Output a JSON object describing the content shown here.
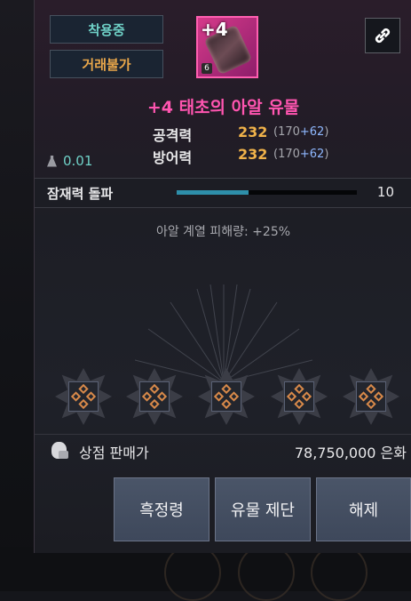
{
  "header": {
    "badge_wearing": "착용중",
    "badge_untradable": "거래불가",
    "item_level": "+4",
    "lock_number": "6",
    "link_icon": "link-icon"
  },
  "item": {
    "name": "+4 태초의 아알 유물",
    "name_color": "#ff55b0"
  },
  "stats": [
    {
      "label": "공격력",
      "value": "232",
      "base": "(170",
      "bonus": "+62",
      "close": ")"
    },
    {
      "label": "방어력",
      "value": "232",
      "base": "(170",
      "bonus": "+62",
      "close": ")"
    }
  ],
  "weight": "0.01",
  "potential": {
    "label": "잠재력 돌파",
    "value": "10",
    "fill_fraction": 0.4
  },
  "effect_text": "아알 계열 피해량: +25%",
  "sockets": [
    "rune-icon",
    "rune-icon",
    "rune-icon",
    "rune-icon",
    "rune-icon"
  ],
  "shop": {
    "label": "상점 판매가",
    "price": "78,750,000 은화"
  },
  "buttons": {
    "black_spirit": "흑정령",
    "relic_craft": "유물 제단",
    "unequip": "해제"
  }
}
